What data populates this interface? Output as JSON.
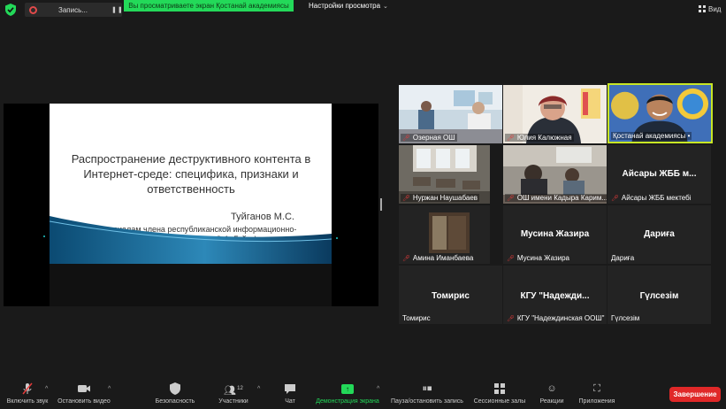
{
  "topbar": {
    "recording_label": "Запись...",
    "share_banner": "Вы просматриваете экран Қостанай академиясы",
    "view_settings": "Настройки просмотра",
    "view_label": "Вид"
  },
  "slide": {
    "title": "Распространение деструктивного контента в Интернет-среде: специфика, признаки и ответственность",
    "author": "Туйганов М.С.",
    "subtitle": "(по материалам члена республиканской информационно-разъяснительной группы О.А. Гайко)"
  },
  "participants": [
    {
      "name": "Озерная ОШ",
      "muted": true
    },
    {
      "name": "Юлия Калюжная",
      "muted": true
    },
    {
      "name": "Қостанай академиясы •",
      "muted": false
    },
    {
      "name": "Нуржан Наушабаев",
      "muted": true
    },
    {
      "name": "ОШ имени Кадыра Карим...",
      "muted": true
    },
    {
      "name": "Айсары ЖББ мектебі",
      "muted": true,
      "display": "Айсары ЖББ м..."
    },
    {
      "name": "Амина Иманбаева",
      "muted": true
    },
    {
      "name": "Мусина Жазира",
      "muted": true,
      "display": "Мусина Жазира"
    },
    {
      "name": "Дариға",
      "muted": false,
      "display": "Дариға"
    },
    {
      "name": "Томирис",
      "muted": false,
      "display": "Томирис"
    },
    {
      "name": "КГУ \"Надеждинская ООШ\"",
      "muted": true,
      "display": "КГУ \"Надежди..."
    },
    {
      "name": "Гүлсезім",
      "muted": false,
      "display": "Гүлсезім"
    }
  ],
  "toolbar": {
    "mute": "Включить звук",
    "video": "Остановить видео",
    "security": "Безопасность",
    "participants": "Участники",
    "participants_count": "12",
    "chat": "Чат",
    "share": "Демонстрация экрана",
    "pause_record": "Пауза/остановить запись",
    "breakout": "Сессионные залы",
    "reactions": "Реакции",
    "apps": "Приложения",
    "end": "Завершение"
  },
  "colors": {
    "share_green": "#23d959",
    "end_red": "#e02828",
    "active_speaker": "#c8e625",
    "mute_red": "#e63b3b"
  }
}
